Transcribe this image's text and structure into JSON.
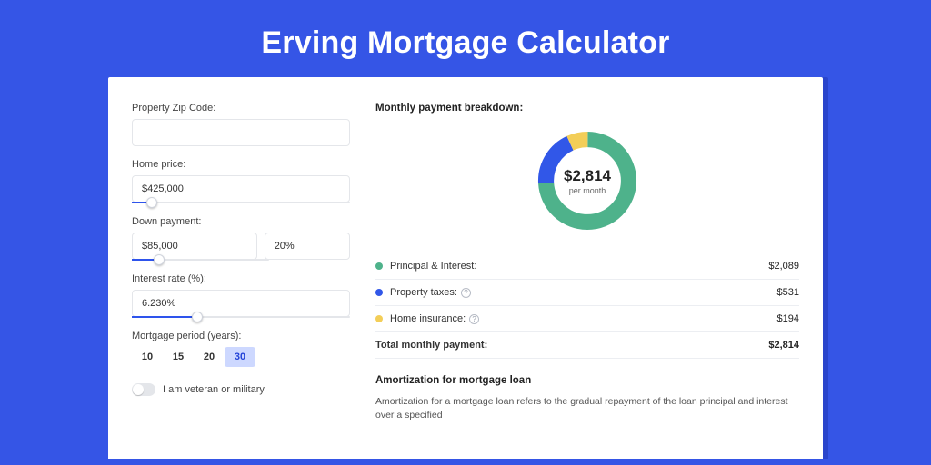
{
  "title": "Erving Mortgage Calculator",
  "form": {
    "zip": {
      "label": "Property Zip Code:",
      "value": ""
    },
    "price": {
      "label": "Home price:",
      "value": "$425,000",
      "slider_pct": 9
    },
    "down": {
      "label": "Down payment:",
      "amount": "$85,000",
      "pct": "20%",
      "slider_pct": 20
    },
    "rate": {
      "label": "Interest rate (%):",
      "value": "6.230%",
      "slider_pct": 30
    },
    "period": {
      "label": "Mortgage period (years):",
      "options": [
        "10",
        "15",
        "20",
        "30"
      ],
      "selected": "30"
    },
    "vet": {
      "label": "I am veteran or military",
      "on": false
    }
  },
  "breakdown": {
    "title": "Monthly payment breakdown:",
    "total_big": "$2,814",
    "total_sub": "per month",
    "items": [
      {
        "color": "#4eb28b",
        "label": "Principal & Interest:",
        "value": "$2,089",
        "help": false,
        "pct": 74
      },
      {
        "color": "#3157e8",
        "label": "Property taxes:",
        "value": "$531",
        "help": true,
        "pct": 19
      },
      {
        "color": "#f3ce58",
        "label": "Home insurance:",
        "value": "$194",
        "help": true,
        "pct": 7
      }
    ],
    "total_row": {
      "label": "Total monthly payment:",
      "value": "$2,814"
    }
  },
  "amort": {
    "title": "Amortization for mortgage loan",
    "body": "Amortization for a mortgage loan refers to the gradual repayment of the loan principal and interest over a specified"
  },
  "chart_data": {
    "type": "pie",
    "title": "Monthly payment breakdown",
    "series": [
      {
        "name": "Principal & Interest",
        "value": 2089,
        "color": "#4eb28b"
      },
      {
        "name": "Property taxes",
        "value": 531,
        "color": "#3157e8"
      },
      {
        "name": "Home insurance",
        "value": 194,
        "color": "#f3ce58"
      }
    ],
    "total": 2814,
    "unit": "USD per month"
  }
}
